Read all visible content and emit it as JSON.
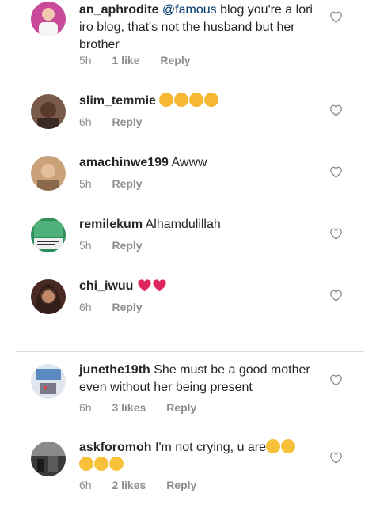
{
  "comments": [
    {
      "username": "an_aphrodite",
      "mention": "@famous",
      "text": " blog you're a lori iro blog, that's not the husband but her brother",
      "time": "5h",
      "likes": "1 like",
      "reply": "Reply"
    },
    {
      "username": "slim_temmie",
      "text": "",
      "emoji": [
        "loudly-crying-face-emoji",
        "loudly-crying-face-emoji",
        "loudly-crying-face-emoji",
        "loudly-crying-face-emoji"
      ],
      "time": "6h",
      "reply": "Reply"
    },
    {
      "username": "amachinwe199",
      "text": "Awww",
      "time": "5h",
      "reply": "Reply"
    },
    {
      "username": "remilekum",
      "text": "Alhamdulillah",
      "time": "5h",
      "reply": "Reply"
    },
    {
      "username": "chi_iwuu",
      "text": "",
      "emoji": [
        "red-heart-emoji",
        "red-heart-emoji"
      ],
      "time": "6h",
      "reply": "Reply"
    },
    {
      "username": "junethe19th",
      "text": "She must be a good mother even without her being present",
      "time": "6h",
      "likes": "3 likes",
      "reply": "Reply"
    },
    {
      "username": "askforomoh",
      "text": "I'm not crying, u are",
      "emoji": [
        "sad-face-emoji",
        "sad-face-emoji",
        "sad-face-emoji",
        "sad-face-emoji",
        "sad-face-emoji"
      ],
      "time": "6h",
      "likes": "2 likes",
      "reply": "Reply"
    }
  ],
  "colors": {
    "text": "#262626",
    "meta": "#8e8e8e",
    "mention": "#00376b",
    "divider": "#dbdbdb",
    "heart_outline": "#8e8e8e",
    "red_heart": "#e0245e"
  }
}
